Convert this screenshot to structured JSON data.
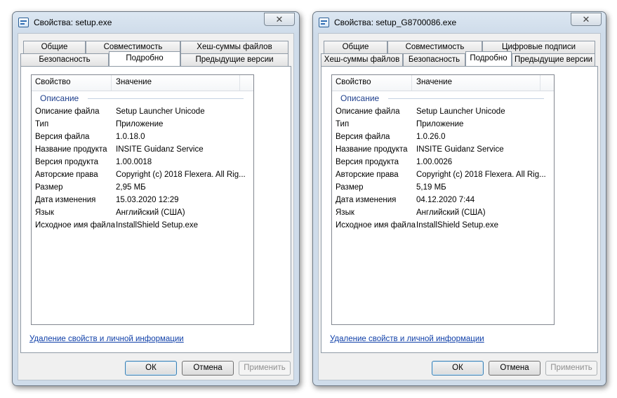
{
  "dialogs": [
    {
      "title": "Свойства: setup.exe",
      "close_glyph": "✕",
      "tabs_top": [
        "Общие",
        "Совместимость",
        "Хеш-суммы файлов"
      ],
      "tabs_bottom": [
        "Безопасность",
        "Подробно",
        "Предыдущие версии"
      ],
      "active_tab": "Подробно",
      "columns": [
        "Свойство",
        "Значение"
      ],
      "group": "Описание",
      "rows": [
        [
          "Описание файла",
          "Setup Launcher Unicode"
        ],
        [
          "Тип",
          "Приложение"
        ],
        [
          "Версия файла",
          "1.0.18.0"
        ],
        [
          "Название продукта",
          "INSITE Guidanz Service"
        ],
        [
          "Версия продукта",
          "1.00.0018"
        ],
        [
          "Авторские права",
          "Copyright (c) 2018 Flexera. All Rig..."
        ],
        [
          "Размер",
          "2,95 МБ"
        ],
        [
          "Дата изменения",
          "15.03.2020 12:29"
        ],
        [
          "Язык",
          "Английский (США)"
        ],
        [
          "Исходное имя файла",
          "InstallShield Setup.exe"
        ]
      ],
      "link": "Удаление свойств и личной информации",
      "buttons": {
        "ok": "ОК",
        "cancel": "Отмена",
        "apply": "Применить"
      }
    },
    {
      "title": "Свойства: setup_G8700086.exe",
      "close_glyph": "✕",
      "tabs_top": [
        "Общие",
        "Совместимость",
        "Цифровые подписи"
      ],
      "tabs_bottom": [
        "Хеш-суммы файлов",
        "Безопасность",
        "Подробно",
        "Предыдущие версии"
      ],
      "active_tab": "Подробно",
      "columns": [
        "Свойство",
        "Значение"
      ],
      "group": "Описание",
      "rows": [
        [
          "Описание файла",
          "Setup Launcher Unicode"
        ],
        [
          "Тип",
          "Приложение"
        ],
        [
          "Версия файла",
          "1.0.26.0"
        ],
        [
          "Название продукта",
          "INSITE Guidanz Service"
        ],
        [
          "Версия продукта",
          "1.00.0026"
        ],
        [
          "Авторские права",
          "Copyright (c) 2018 Flexera. All Rig..."
        ],
        [
          "Размер",
          "5,19 МБ"
        ],
        [
          "Дата изменения",
          "04.12.2020 7:44"
        ],
        [
          "Язык",
          "Английский (США)"
        ],
        [
          "Исходное имя файла",
          "InstallShield Setup.exe"
        ]
      ],
      "link": "Удаление свойств и личной информации",
      "buttons": {
        "ok": "ОК",
        "cancel": "Отмена",
        "apply": "Применить"
      }
    }
  ]
}
